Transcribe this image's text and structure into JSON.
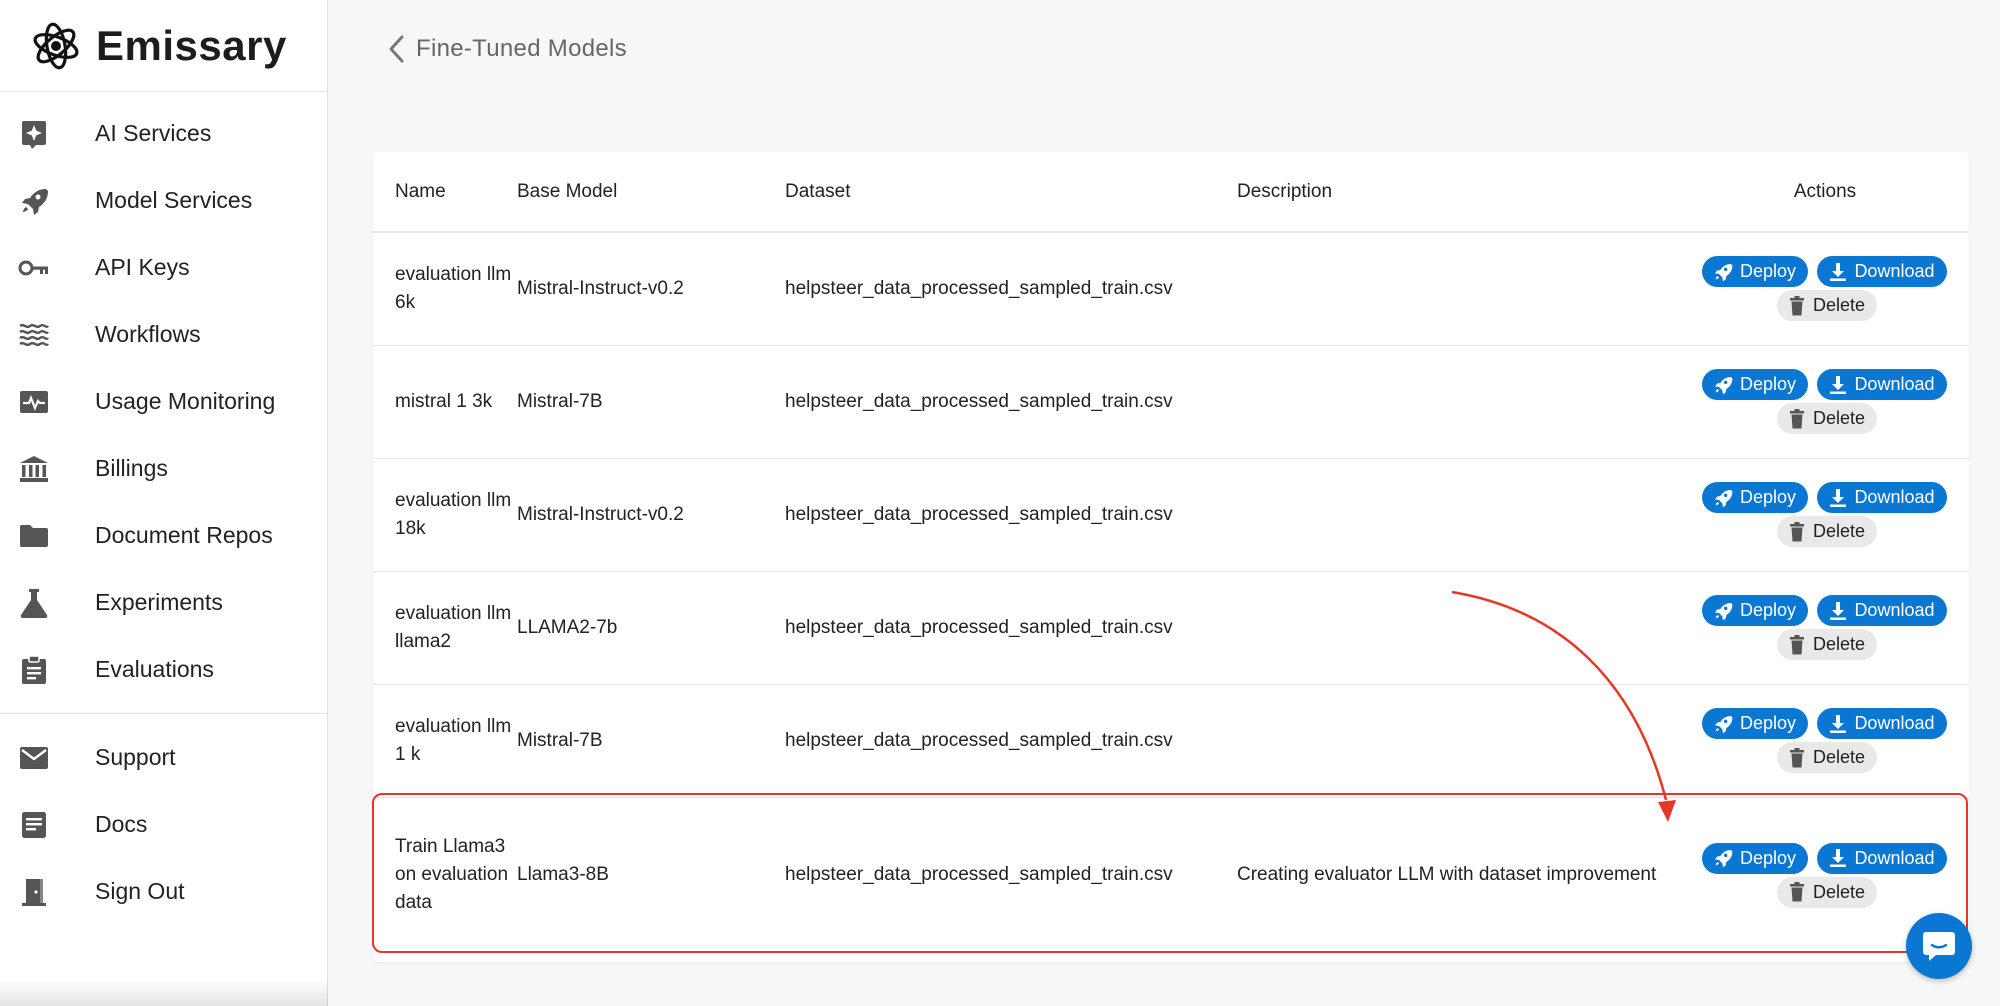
{
  "app": {
    "name": "Emissary"
  },
  "sidebar": {
    "primary": [
      {
        "label": "AI Services",
        "icon": "sparkle-icon"
      },
      {
        "label": "Model Services",
        "icon": "rocket-icon"
      },
      {
        "label": "API Keys",
        "icon": "key-icon"
      },
      {
        "label": "Workflows",
        "icon": "waves-icon"
      },
      {
        "label": "Usage Monitoring",
        "icon": "pulse-monitor-icon"
      },
      {
        "label": "Billings",
        "icon": "bank-icon"
      },
      {
        "label": "Document Repos",
        "icon": "folder-icon"
      },
      {
        "label": "Experiments",
        "icon": "flask-icon"
      },
      {
        "label": "Evaluations",
        "icon": "clipboard-icon"
      }
    ],
    "secondary": [
      {
        "label": "Support",
        "icon": "mail-icon"
      },
      {
        "label": "Docs",
        "icon": "document-icon"
      },
      {
        "label": "Sign Out",
        "icon": "door-exit-icon"
      }
    ]
  },
  "breadcrumb": {
    "back_label": "Fine-Tuned Models"
  },
  "table": {
    "headers": {
      "name": "Name",
      "base": "Base Model",
      "dataset": "Dataset",
      "description": "Description",
      "actions": "Actions"
    },
    "rows": [
      {
        "name": "evaluation llm 6k",
        "base": "Mistral-Instruct-v0.2",
        "dataset": "helpsteer_data_processed_sampled_train.csv",
        "description": ""
      },
      {
        "name": "mistral 1 3k",
        "base": "Mistral-7B",
        "dataset": "helpsteer_data_processed_sampled_train.csv",
        "description": ""
      },
      {
        "name": "evaluation llm 18k",
        "base": "Mistral-Instruct-v0.2",
        "dataset": "helpsteer_data_processed_sampled_train.csv",
        "description": ""
      },
      {
        "name": "evaluation llm llama2",
        "base": "LLAMA2-7b",
        "dataset": "helpsteer_data_processed_sampled_train.csv",
        "description": ""
      },
      {
        "name": "evaluation llm 1 k",
        "base": "Mistral-7B",
        "dataset": "helpsteer_data_processed_sampled_train.csv",
        "description": ""
      },
      {
        "name": "Train Llama3 on evaluation data",
        "base": "Llama3-8B",
        "dataset": "helpsteer_data_processed_sampled_train.csv",
        "description": "Creating evaluator LLM with dataset improvement"
      }
    ],
    "actions": {
      "deploy": "Deploy",
      "download": "Download",
      "delete": "Delete"
    }
  },
  "colors": {
    "accent": "#0a78d2",
    "annotation": "#e53626"
  }
}
